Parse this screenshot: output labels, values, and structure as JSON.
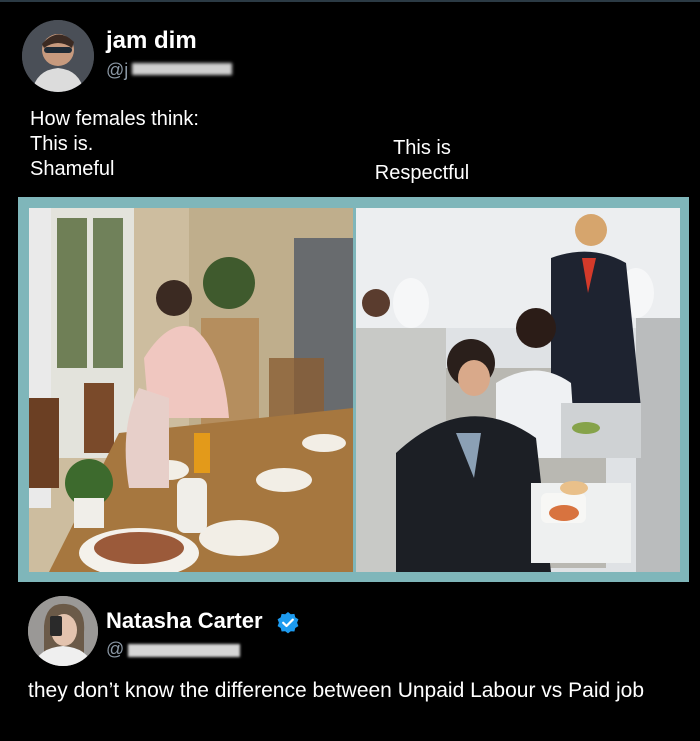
{
  "post": {
    "author_name": "jam dim",
    "author_handle": "@j",
    "text_lines": [
      "How females think:",
      "This is.",
      "Shameful"
    ],
    "right_caption_lines": [
      "This is",
      "Respectful"
    ]
  },
  "reply": {
    "author_name": "Natasha Carter",
    "author_handle": "@",
    "text": "they don’t know the difference between Unpaid Labour vs Paid job"
  },
  "colors": {
    "background": "#000000",
    "handle": "#8b98a5",
    "frame": "#7fb6ba",
    "verified": "#1d9bf0"
  },
  "icons": {
    "verified": "verified-badge-icon"
  }
}
